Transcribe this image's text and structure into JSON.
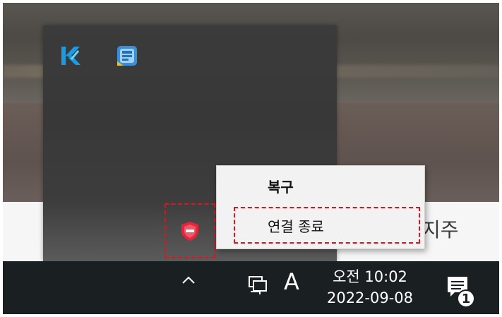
{
  "desktop": {
    "background_text": "지주"
  },
  "tray_flyout": {
    "icons": [
      {
        "name": "k-app-icon",
        "color": "#1e9be0"
      },
      {
        "name": "blue-app-icon",
        "color": "#2a7fd0"
      },
      {
        "name": "red-shield-icon",
        "color": "#e8233a"
      }
    ]
  },
  "context_menu": {
    "items": [
      {
        "label": "복구"
      },
      {
        "label": "연결 종료"
      }
    ],
    "highlight_color": "#e0141e"
  },
  "taskbar": {
    "chevron": "^",
    "ime_indicator": "A",
    "clock_time": "오전 10:02",
    "clock_date": "2022-09-08",
    "notification_count": "1"
  }
}
